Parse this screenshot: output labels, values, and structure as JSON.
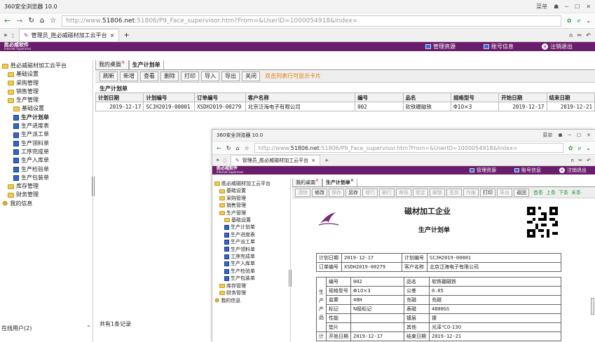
{
  "browser": {
    "title": "360安全浏览器 10.0",
    "menu_label": "菜单",
    "url_gray_prefix": "http://www.",
    "url_host": "51806.net",
    "url_rest": ":51806/P9_Face_supervisor.htm?From=&UserID=1000054918&Index=",
    "tab_label": "管理员_胜必威磁材加工云平台"
  },
  "app": {
    "logo_cn": "胜必威软件",
    "logo_en": "Internet Supervisor",
    "menu": [
      "管理资源",
      "账号信息",
      "注销退出"
    ]
  },
  "sidebar": {
    "root": "胜必威磁材加工云平台",
    "items": [
      "基础设置",
      "采购管理",
      "销售管理",
      "生产管理"
    ],
    "prod_children": [
      "基础设置",
      "生产计划单",
      "生产进度表",
      "生产派工单",
      "生产领料单",
      "工序完成单",
      "生产入库单",
      "生产检验单",
      "生产包装单"
    ],
    "tail_items": [
      "库存管理",
      "财务管理",
      "我的信息"
    ],
    "bottom": "在线用户(2)"
  },
  "page_tabs": [
    "我的桌面",
    "生产计划单"
  ],
  "toolbar": {
    "buttons": [
      "刷新",
      "新增",
      "查看",
      "删除",
      "打印",
      "导入",
      "导出",
      "关闭"
    ],
    "hint": "双击列表行可显示卡片"
  },
  "list": {
    "title": "生产计划单",
    "columns": [
      "计划日期",
      "计划编号",
      "订单编号",
      "客户名称",
      "编号",
      "品名",
      "规格型号",
      "开始日期",
      "结束日期"
    ],
    "rows": [
      [
        "2019-12-17",
        "SCJH2019-00001",
        "XSDH2019-00279",
        "北京泛海电子有限公司",
        "002",
        "软铁硼磁铁",
        "Φ10×3",
        "2019-12-17",
        "2019-12-21"
      ]
    ],
    "footer": "共有1条记录"
  },
  "card": {
    "buttons": [
      "清除",
      "修改",
      "保存",
      "另存",
      "增行",
      "删行",
      "审核",
      "锁定",
      "解锁",
      "签到",
      "作废",
      "打印",
      "导出",
      "返回"
    ],
    "disabled": [
      true,
      false,
      true,
      false,
      true,
      true,
      true,
      true,
      true,
      true,
      true,
      false,
      true,
      false
    ],
    "nav_links": [
      "首条",
      "上条",
      "下条",
      "末条"
    ],
    "company": "磁材加工企业",
    "doc_title": "生产计划单",
    "form": {
      "plan_date_label": "计划日期",
      "plan_date": "2019-12-17",
      "plan_no_label": "计划编号",
      "plan_no": "SCJH2019-00001",
      "order_no_label": "订单编号",
      "order_no": "XSDH2019-00279",
      "customer_label": "客户名称",
      "customer": "北京泛海电子有限公司",
      "group_product": "生产产品",
      "group_plan": "计",
      "rows": [
        [
          "编号",
          "002",
          "品名",
          "软铁硼磁铁"
        ],
        [
          "规格型号",
          "Φ10×3",
          "公差",
          "0.05"
        ],
        [
          "盐雾",
          "48H",
          "充磁",
          "充磁"
        ],
        [
          "标记",
          "N极标记",
          "表磁",
          "4800GS"
        ],
        [
          "性能",
          "",
          "镀层",
          "镍"
        ],
        [
          "垫片",
          "",
          "其他",
          "光泽℃0-130"
        ],
        [
          "开始日期",
          "2019-12-17",
          "结束日期",
          "2019-12-21"
        ]
      ]
    }
  }
}
